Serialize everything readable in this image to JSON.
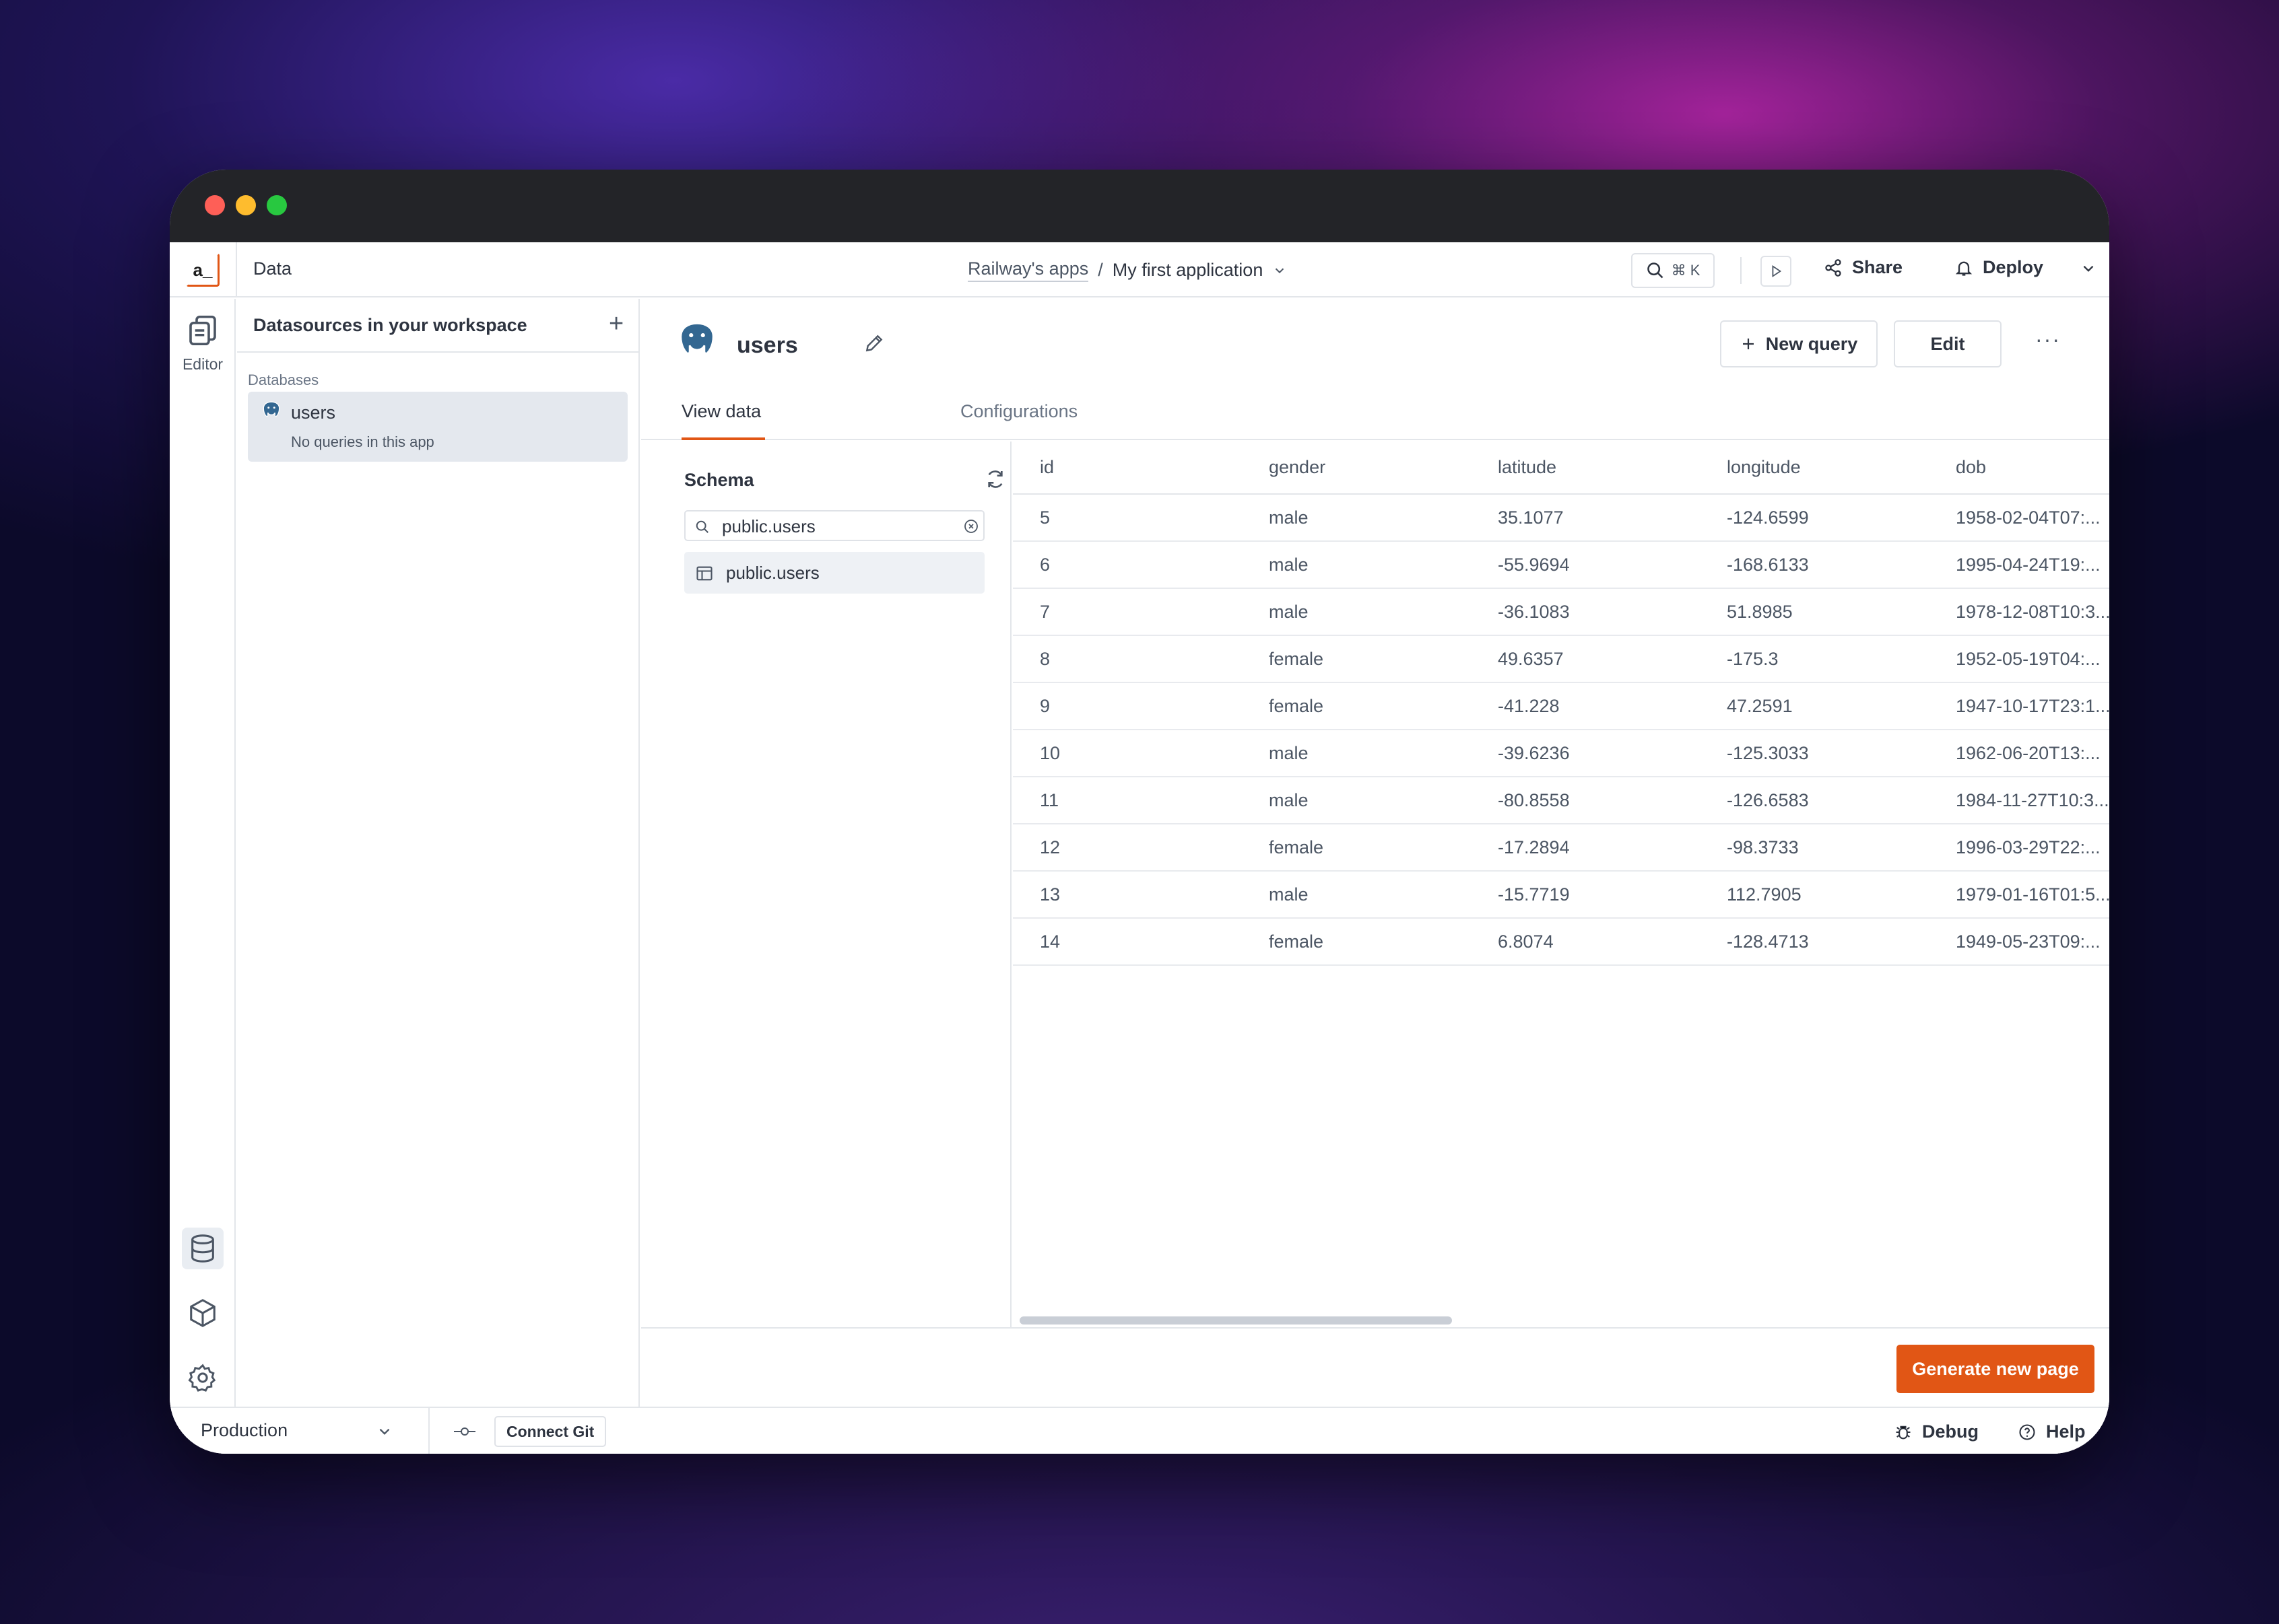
{
  "header": {
    "title": "Data",
    "logo_text": "a_",
    "breadcrumb": {
      "workspace": "Railway's apps",
      "separator": "/",
      "application": "My first application"
    },
    "search_shortcut": "⌘ K",
    "share_label": "Share",
    "deploy_label": "Deploy"
  },
  "rail": {
    "editor_label": "Editor"
  },
  "datasources": {
    "title": "Datasources in your workspace",
    "add": "+",
    "section": "Databases",
    "items": [
      {
        "name": "users",
        "subtitle": "No queries in this app"
      }
    ]
  },
  "main": {
    "datasource_name": "users",
    "new_query_label": "New query",
    "edit_label": "Edit",
    "more_label": "···",
    "tabs": [
      {
        "label": "View data"
      },
      {
        "label": "Configurations"
      }
    ],
    "schema": {
      "title": "Schema",
      "search_value": "public.users",
      "tables": [
        "public.users"
      ]
    },
    "table": {
      "columns": [
        "id",
        "gender",
        "latitude",
        "longitude",
        "dob"
      ],
      "rows": [
        [
          "5",
          "male",
          "35.1077",
          "-124.6599",
          "1958-02-04T07:..."
        ],
        [
          "6",
          "male",
          "-55.9694",
          "-168.6133",
          "1995-04-24T19:..."
        ],
        [
          "7",
          "male",
          "-36.1083",
          "51.8985",
          "1978-12-08T10:3..."
        ],
        [
          "8",
          "female",
          "49.6357",
          "-175.3",
          "1952-05-19T04:..."
        ],
        [
          "9",
          "female",
          "-41.228",
          "47.2591",
          "1947-10-17T23:1..."
        ],
        [
          "10",
          "male",
          "-39.6236",
          "-125.3033",
          "1962-06-20T13:..."
        ],
        [
          "11",
          "male",
          "-80.8558",
          "-126.6583",
          "1984-11-27T10:3..."
        ],
        [
          "12",
          "female",
          "-17.2894",
          "-98.3733",
          "1996-03-29T22:..."
        ],
        [
          "13",
          "male",
          "-15.7719",
          "112.7905",
          "1979-01-16T01:5..."
        ],
        [
          "14",
          "female",
          "6.8074",
          "-128.4713",
          "1949-05-23T09:..."
        ]
      ]
    },
    "generate_label": "Generate new page"
  },
  "bottom": {
    "environment": "Production",
    "connect_git_label": "Connect Git",
    "debug_label": "Debug",
    "help_label": "Help"
  },
  "colors": {
    "accent": "#e15615",
    "titlebar": "#232428",
    "selected_bg": "#e4e8ee"
  }
}
